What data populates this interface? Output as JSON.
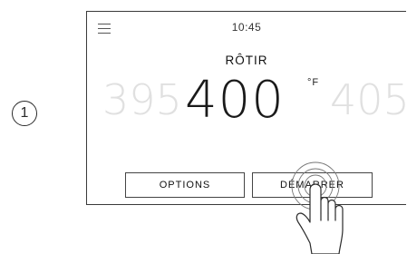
{
  "step": {
    "number": "1"
  },
  "screen": {
    "time": "10:45",
    "mode": "RÔTIR",
    "temperature": {
      "previous": "395",
      "current": "400",
      "next": "405",
      "unit": "°F"
    },
    "buttons": {
      "options": "OPTIONS",
      "start": "DÉMARRER"
    }
  },
  "icons": {
    "menu": "hamburger-menu-icon",
    "touch": "hand-pointer-icon"
  }
}
